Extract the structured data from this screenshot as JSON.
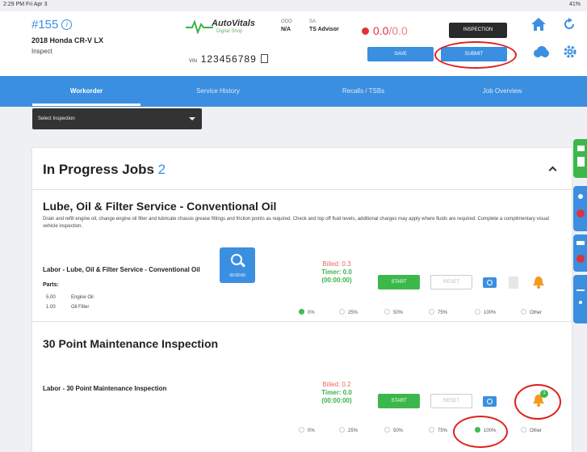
{
  "status_bar": {
    "time": "2:29 PM  Fri Apr 3",
    "right": "41%"
  },
  "header": {
    "ro_number": "#155",
    "vehicle": "2018 Honda CR-V LX",
    "status": "Inspect",
    "logo_name": "AutoVitals",
    "logo_tagline": "Digital Shop",
    "col1_label": "ODO",
    "col1_value": "N/A",
    "col2_label": "SA",
    "col2_value": "TS Advisor",
    "vin_label": "VIN",
    "vin_value": "123456789",
    "price_current": "0.0",
    "price_total": "/0.0",
    "inspection_button": "INSPECTION",
    "save_button": "SAVE",
    "submit_button": "SUBMIT"
  },
  "tabs": [
    {
      "label": "Workorder",
      "active": true
    },
    {
      "label": "Service History"
    },
    {
      "label": "Recalls / TSBs"
    },
    {
      "label": "Job Overview"
    }
  ],
  "select_inspection": {
    "value": "Select Inspection"
  },
  "card": {
    "title": "In Progress Jobs",
    "count": "2",
    "jobs": [
      {
        "title": "Lube, Oil & Filter Service - Conventional Oil",
        "description": "Drain and refill engine oil, change engine oil filter and lubricate chassis grease fittings and friction points as required. Check and top off fluid levels, additional charges may apply where fluids are required. Complete a complimentary visual vehicle inspection.",
        "labor": "Labor - Lube, Oil & Filter Service - Conventional Oil",
        "parts_label": "Parts:",
        "parts": [
          {
            "qty": "5.00",
            "name": "Engine Oil"
          },
          {
            "qty": "1.00",
            "name": "Oil Filter"
          }
        ],
        "billed": "Billed: 0.3",
        "timer": "Timer: 0.0",
        "clock": "(00:00:00)",
        "start": "START",
        "reset": "RESET",
        "progress": [
          "0%",
          "25%",
          "50%",
          "75%",
          "100%",
          "Other"
        ],
        "selected": "0%"
      },
      {
        "title": "30 Point Maintenance Inspection",
        "labor": "Labor - 30 Point Maintenance Inspection",
        "billed": "Billed: 0.2",
        "timer": "Timer: 0.0",
        "clock": "(00:00:00)",
        "start": "START",
        "reset": "RESET",
        "inspection_timer": "00:00:00",
        "notification_count": "1",
        "progress": [
          "0%",
          "25%",
          "50%",
          "75%",
          "100%",
          "Other"
        ],
        "selected": "100%"
      }
    ]
  },
  "colors": {
    "accent": "#3b8fe0",
    "success": "#3cb84b",
    "alert": "#e0323a",
    "warning": "#f39a1e"
  }
}
